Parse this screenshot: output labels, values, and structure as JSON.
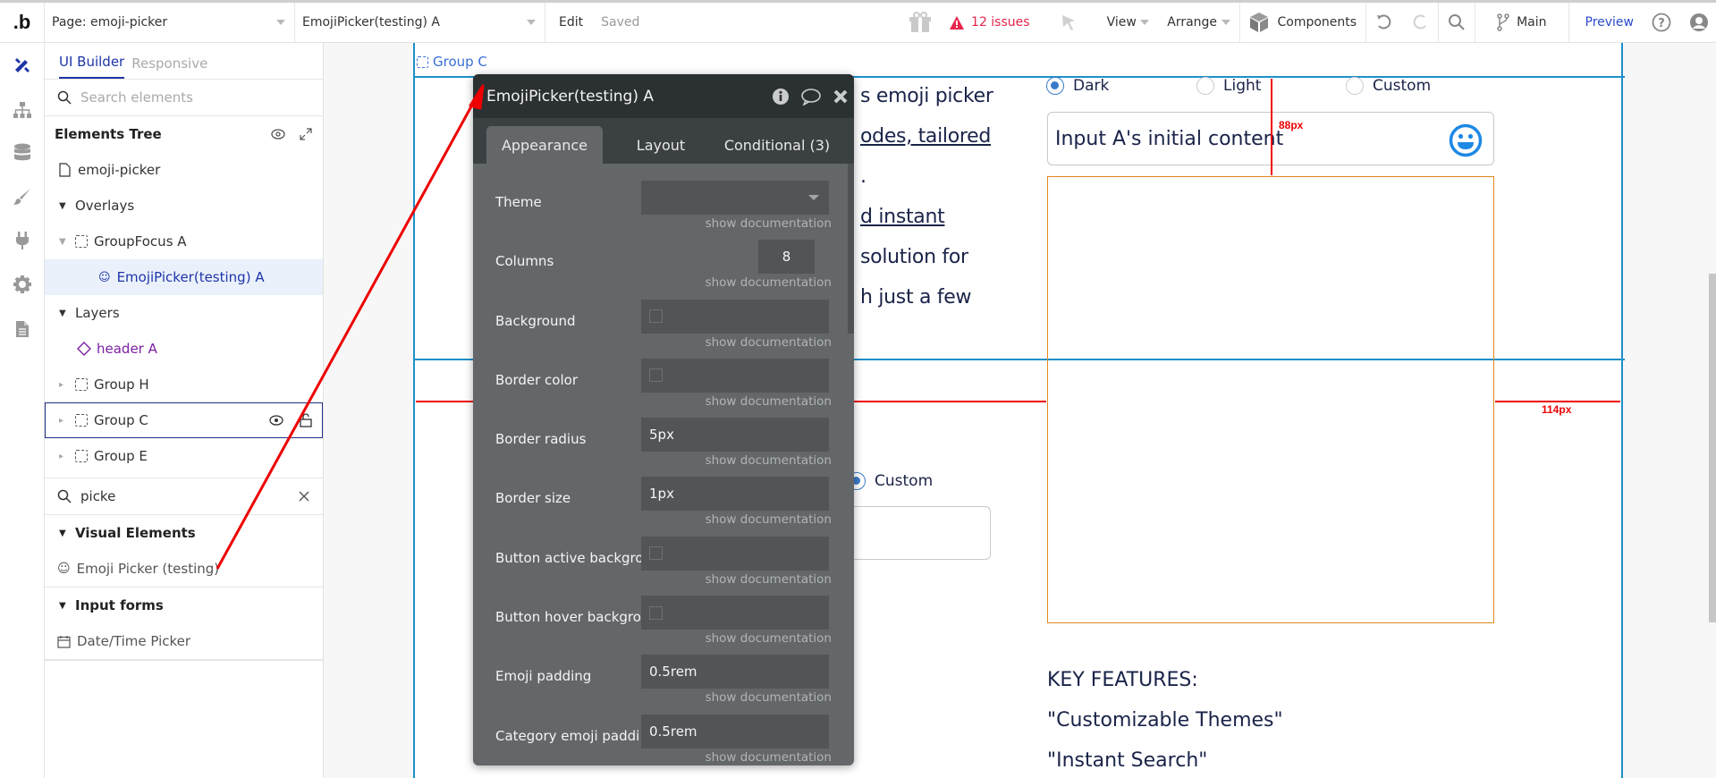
{
  "topbar": {
    "logo": ".b",
    "page_selector": "Page: emoji-picker",
    "element_selector": "EmojiPicker(testing) A",
    "edit": "Edit",
    "saved": "Saved",
    "issues": "12 issues",
    "view": "View",
    "arrange": "Arrange",
    "components": "Components",
    "branch": "Main",
    "preview": "Preview"
  },
  "iconbar": [
    "design-icon",
    "sitemap-icon",
    "database-icon",
    "brush-icon",
    "plug-icon",
    "gear-icon",
    "document-icon"
  ],
  "panel": {
    "tabs": [
      "UI Builder",
      "Responsive"
    ],
    "search_placeholder": "Search elements",
    "tree_title": "Elements Tree",
    "tree": {
      "page": "emoji-picker",
      "overlays": "Overlays",
      "group_focus": "GroupFocus A",
      "emoji_picker": "EmojiPicker(testing) A",
      "layers": "Layers",
      "header": "header A",
      "group_h": "Group H",
      "group_c": "Group C",
      "group_e": "Group E"
    },
    "element_search_value": "picke",
    "visual_elements": "Visual Elements",
    "visual_item": "Emoji Picker (testing)",
    "input_forms": "Input forms",
    "input_item": "Date/Time Picker"
  },
  "canvas": {
    "group_label": "Group C",
    "text_lines": [
      "s emoji picker",
      "odes, tailored",
      ".",
      "d instant ",
      "solution for",
      "h just a few"
    ],
    "radios": [
      {
        "label": "Dark",
        "checked": true
      },
      {
        "label": "Light",
        "checked": false
      },
      {
        "label": "Custom",
        "checked": false
      }
    ],
    "input_value": "Input A's initial content",
    "measure_vertical": "88px",
    "measure_horizontal": "114px",
    "lower_radio": "Custom",
    "features_title": "KEY FEATURES:",
    "features": [
      "\"Customizable Themes\"",
      "\"Instant Search\""
    ]
  },
  "property_editor": {
    "title": "EmojiPicker(testing) A",
    "tabs": [
      "Appearance",
      "Layout",
      "Conditional (3)"
    ],
    "doc_link": "show documentation",
    "properties": [
      {
        "label": "Theme",
        "type": "dropdown",
        "value": ""
      },
      {
        "label": "Columns",
        "type": "number",
        "value": "8"
      },
      {
        "label": "Background",
        "type": "color",
        "value": ""
      },
      {
        "label": "Border color",
        "type": "color",
        "value": ""
      },
      {
        "label": "Border radius",
        "type": "text",
        "value": "5px"
      },
      {
        "label": "Border size",
        "type": "text",
        "value": "1px"
      },
      {
        "label": "Button active backgro",
        "type": "color",
        "value": ""
      },
      {
        "label": "Button hover backgro",
        "type": "color",
        "value": ""
      },
      {
        "label": "Emoji padding",
        "type": "text",
        "value": "0.5rem"
      },
      {
        "label": "Category emoji paddi",
        "type": "text",
        "value": "0.5rem"
      }
    ]
  },
  "colors": {
    "accent": "#1d34a8",
    "issues": "#e8244c",
    "group_outline": "#1e90c8",
    "picker_outline": "#e08a1e",
    "annotation_arrow": "#ee0000"
  }
}
